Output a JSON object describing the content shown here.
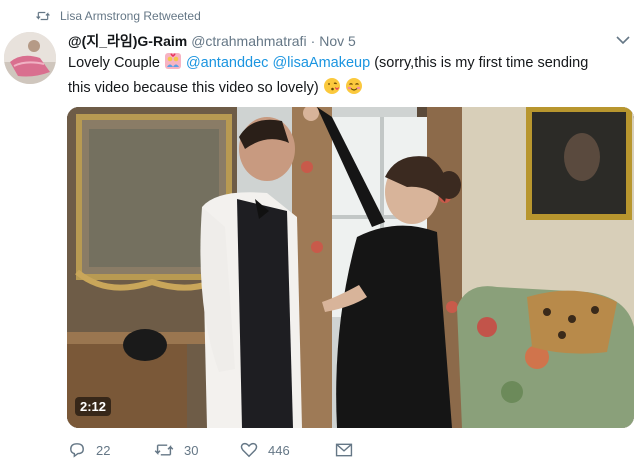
{
  "retweet_context": {
    "icon": "retweet-icon",
    "text": "Lisa Armstrong Retweeted"
  },
  "tweet": {
    "display_name": "@(지_라임)G-Raim",
    "handle": "@ctrahmahmatrafi",
    "separator": "·",
    "time": "Nov 5",
    "text_parts": {
      "t1": "Lovely Couple ",
      "m1": "@antanddec",
      "m2": "@lisaAmakeup",
      "t2": " (sorry,this is my first time sending this video because this video so lovely) "
    },
    "emojis": [
      "couple-with-heart-emoji",
      "face-blowing-kiss-emoji",
      "smiling-face-with-smiling-eyes-emoji"
    ],
    "video": {
      "duration": "2:12"
    }
  },
  "actions": {
    "reply_count": "22",
    "retweet_count": "30",
    "like_count": "446"
  },
  "colors": {
    "link": "#1b95e0",
    "secondary_text": "#657786",
    "primary_text": "#14171a"
  }
}
